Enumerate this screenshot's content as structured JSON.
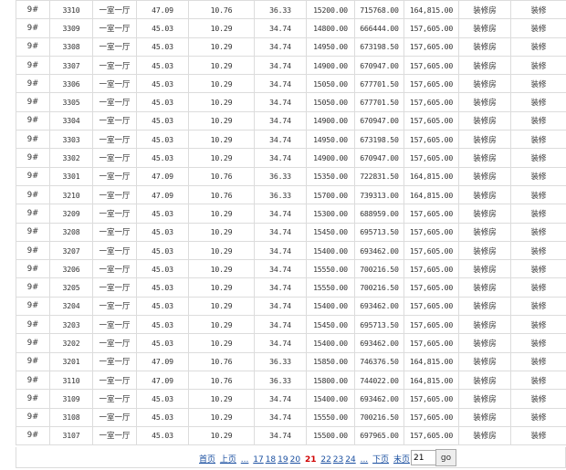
{
  "table": {
    "rows": [
      [
        "9#",
        "3310",
        "一室一厅",
        "47.09",
        "10.76",
        "36.33",
        "15200.00",
        "715768.00",
        "164,815.00",
        "装修房",
        "装修"
      ],
      [
        "9#",
        "3309",
        "一室一厅",
        "45.03",
        "10.29",
        "34.74",
        "14800.00",
        "666444.00",
        "157,605.00",
        "装修房",
        "装修"
      ],
      [
        "9#",
        "3308",
        "一室一厅",
        "45.03",
        "10.29",
        "34.74",
        "14950.00",
        "673198.50",
        "157,605.00",
        "装修房",
        "装修"
      ],
      [
        "9#",
        "3307",
        "一室一厅",
        "45.03",
        "10.29",
        "34.74",
        "14900.00",
        "670947.00",
        "157,605.00",
        "装修房",
        "装修"
      ],
      [
        "9#",
        "3306",
        "一室一厅",
        "45.03",
        "10.29",
        "34.74",
        "15050.00",
        "677701.50",
        "157,605.00",
        "装修房",
        "装修"
      ],
      [
        "9#",
        "3305",
        "一室一厅",
        "45.03",
        "10.29",
        "34.74",
        "15050.00",
        "677701.50",
        "157,605.00",
        "装修房",
        "装修"
      ],
      [
        "9#",
        "3304",
        "一室一厅",
        "45.03",
        "10.29",
        "34.74",
        "14900.00",
        "670947.00",
        "157,605.00",
        "装修房",
        "装修"
      ],
      [
        "9#",
        "3303",
        "一室一厅",
        "45.03",
        "10.29",
        "34.74",
        "14950.00",
        "673198.50",
        "157,605.00",
        "装修房",
        "装修"
      ],
      [
        "9#",
        "3302",
        "一室一厅",
        "45.03",
        "10.29",
        "34.74",
        "14900.00",
        "670947.00",
        "157,605.00",
        "装修房",
        "装修"
      ],
      [
        "9#",
        "3301",
        "一室一厅",
        "47.09",
        "10.76",
        "36.33",
        "15350.00",
        "722831.50",
        "164,815.00",
        "装修房",
        "装修"
      ],
      [
        "9#",
        "3210",
        "一室一厅",
        "47.09",
        "10.76",
        "36.33",
        "15700.00",
        "739313.00",
        "164,815.00",
        "装修房",
        "装修"
      ],
      [
        "9#",
        "3209",
        "一室一厅",
        "45.03",
        "10.29",
        "34.74",
        "15300.00",
        "688959.00",
        "157,605.00",
        "装修房",
        "装修"
      ],
      [
        "9#",
        "3208",
        "一室一厅",
        "45.03",
        "10.29",
        "34.74",
        "15450.00",
        "695713.50",
        "157,605.00",
        "装修房",
        "装修"
      ],
      [
        "9#",
        "3207",
        "一室一厅",
        "45.03",
        "10.29",
        "34.74",
        "15400.00",
        "693462.00",
        "157,605.00",
        "装修房",
        "装修"
      ],
      [
        "9#",
        "3206",
        "一室一厅",
        "45.03",
        "10.29",
        "34.74",
        "15550.00",
        "700216.50",
        "157,605.00",
        "装修房",
        "装修"
      ],
      [
        "9#",
        "3205",
        "一室一厅",
        "45.03",
        "10.29",
        "34.74",
        "15550.00",
        "700216.50",
        "157,605.00",
        "装修房",
        "装修"
      ],
      [
        "9#",
        "3204",
        "一室一厅",
        "45.03",
        "10.29",
        "34.74",
        "15400.00",
        "693462.00",
        "157,605.00",
        "装修房",
        "装修"
      ],
      [
        "9#",
        "3203",
        "一室一厅",
        "45.03",
        "10.29",
        "34.74",
        "15450.00",
        "695713.50",
        "157,605.00",
        "装修房",
        "装修"
      ],
      [
        "9#",
        "3202",
        "一室一厅",
        "45.03",
        "10.29",
        "34.74",
        "15400.00",
        "693462.00",
        "157,605.00",
        "装修房",
        "装修"
      ],
      [
        "9#",
        "3201",
        "一室一厅",
        "47.09",
        "10.76",
        "36.33",
        "15850.00",
        "746376.50",
        "164,815.00",
        "装修房",
        "装修"
      ],
      [
        "9#",
        "3110",
        "一室一厅",
        "47.09",
        "10.76",
        "36.33",
        "15800.00",
        "744022.00",
        "164,815.00",
        "装修房",
        "装修"
      ],
      [
        "9#",
        "3109",
        "一室一厅",
        "45.03",
        "10.29",
        "34.74",
        "15400.00",
        "693462.00",
        "157,605.00",
        "装修房",
        "装修"
      ],
      [
        "9#",
        "3108",
        "一室一厅",
        "45.03",
        "10.29",
        "34.74",
        "15550.00",
        "700216.50",
        "157,605.00",
        "装修房",
        "装修"
      ],
      [
        "9#",
        "3107",
        "一室一厅",
        "45.03",
        "10.29",
        "34.74",
        "15500.00",
        "697965.00",
        "157,605.00",
        "装修房",
        "装修"
      ]
    ]
  },
  "pager": {
    "first": "首页",
    "prev": "上页",
    "dots_before": "...",
    "pages_before": [
      "17",
      "18",
      "19",
      "20"
    ],
    "current": "21",
    "pages_after": [
      "22",
      "23",
      "24"
    ],
    "dots_after": "...",
    "next": "下页",
    "last": "末页",
    "input_value": "21",
    "go_label": "go"
  },
  "colors": {
    "border": "#dcdcdc",
    "link": "#1a4fa0",
    "current_page": "#d00000"
  }
}
